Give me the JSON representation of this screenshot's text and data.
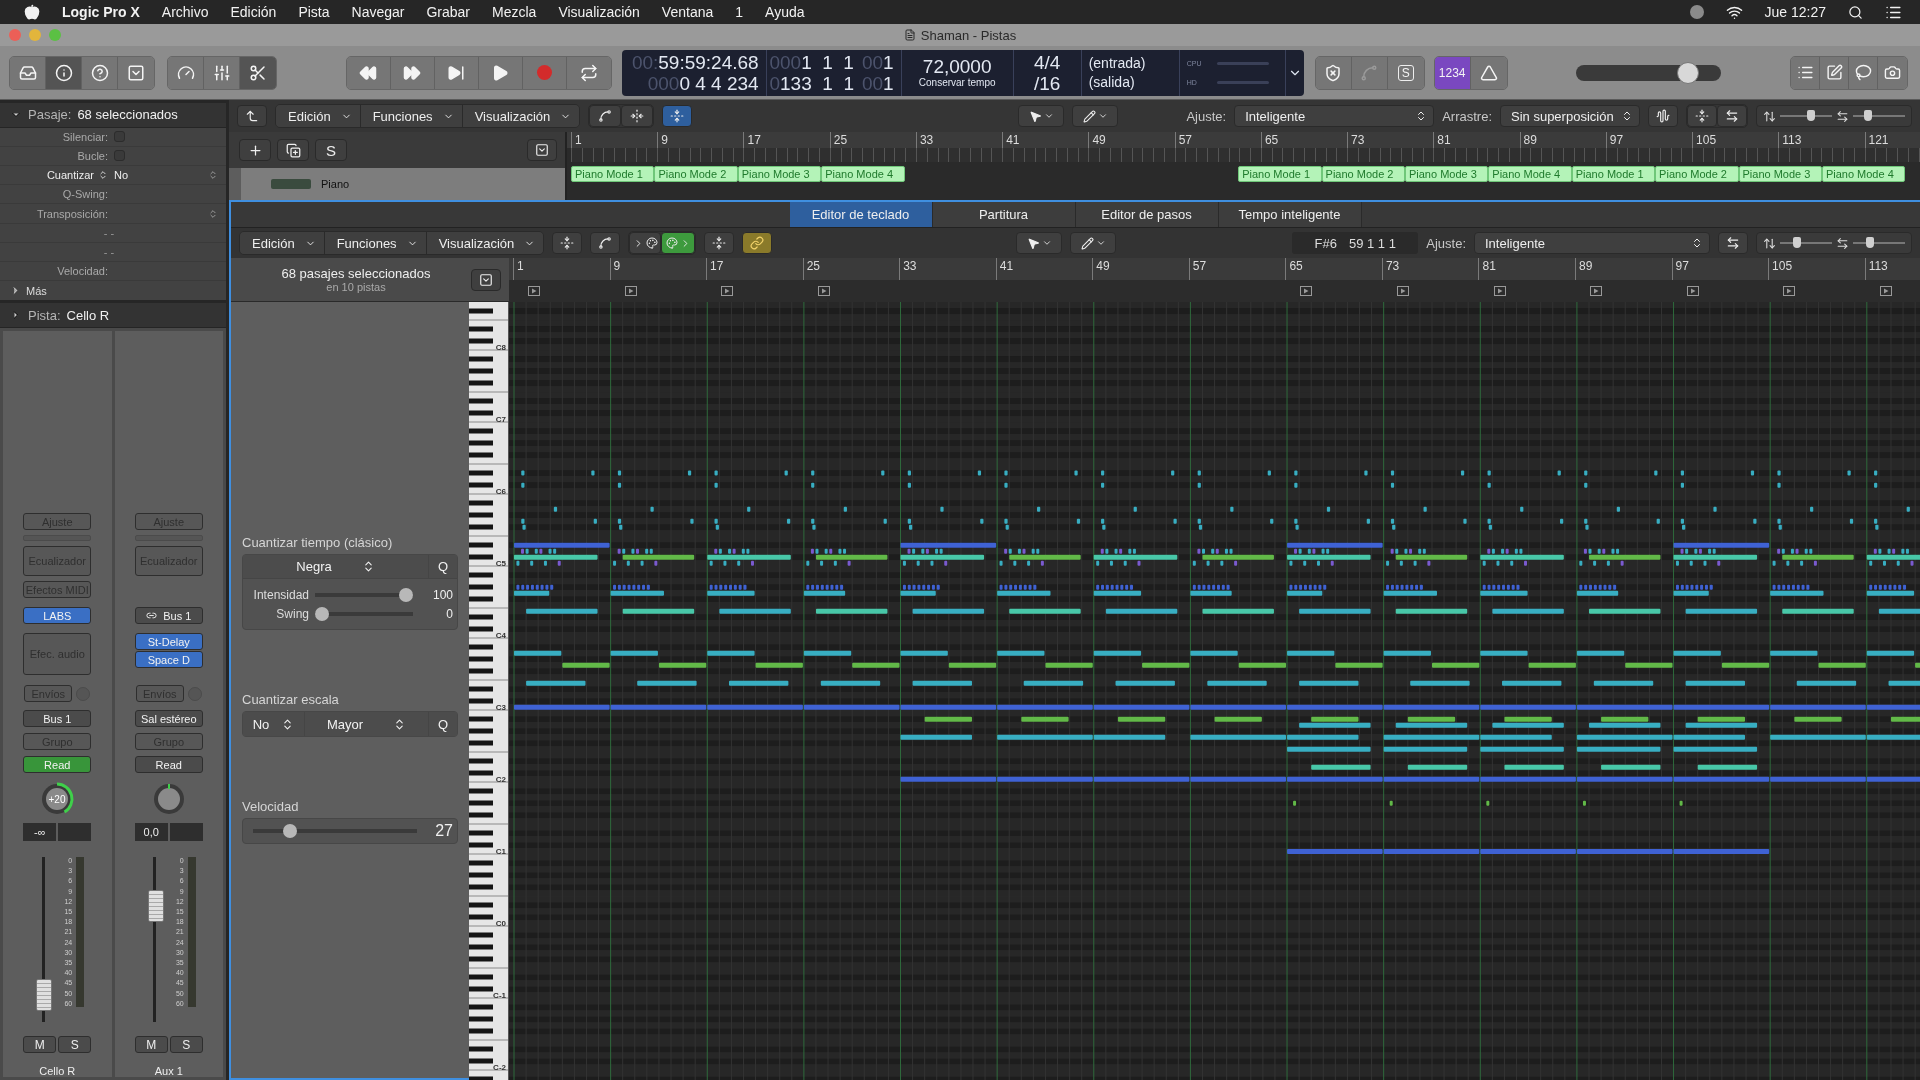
{
  "menu_bar": {
    "app": "Logic Pro X",
    "items": [
      "Archivo",
      "Edición",
      "Pista",
      "Navegar",
      "Grabar",
      "Mezcla",
      "Visualización",
      "Ventana",
      "1",
      "Ayuda"
    ],
    "clock": "Jue 12:27"
  },
  "window": {
    "title": "Shaman - Pistas"
  },
  "control_bar": {
    "view_buttons": [
      {
        "kind": "library",
        "on": false
      },
      {
        "kind": "inspector",
        "on": true
      },
      {
        "kind": "help",
        "on": false
      },
      {
        "kind": "toolbar",
        "on": false
      }
    ],
    "panel_buttons": [
      {
        "kind": "smart",
        "on": false
      },
      {
        "kind": "mixer",
        "on": false
      },
      {
        "kind": "editors",
        "on": true
      }
    ],
    "lcd": {
      "time": [
        [
          {
            "text": "00:",
            "dim": true
          },
          {
            "text": "59:59:24.68",
            "dim": false
          }
        ],
        [
          {
            "text": "000",
            "dim": true
          },
          {
            "text": "0 4 4 234",
            "dim": false
          }
        ]
      ],
      "locators": [
        [
          {
            "text": "000",
            "dim": true
          },
          {
            "text": "1  1  1",
            "dim": false
          },
          {
            "text": "00",
            "dim": true
          },
          {
            "text": "1",
            "dim": false
          }
        ],
        [
          {
            "text": "0",
            "dim": true
          },
          {
            "text": "133  1  1",
            "dim": false
          },
          {
            "text": "00",
            "dim": true
          },
          {
            "text": "1",
            "dim": false
          }
        ]
      ],
      "tempo": {
        "value": "72,0000",
        "mode": "Conservar tempo"
      },
      "signature": {
        "top": "4/4",
        "bottom": "/16"
      },
      "ports": {
        "top": "(entrada)",
        "bottom": "(salida)"
      },
      "meters": [
        "CPU",
        "HD"
      ]
    },
    "mode_buttons": [
      {
        "kind": "latency",
        "disabled": false
      },
      {
        "kind": "tuner",
        "disabled": true
      },
      {
        "kind": "solo",
        "label": "S",
        "disabled": false
      }
    ],
    "count_in": {
      "label": "1234",
      "on": true
    },
    "metronome": {
      "on": false
    },
    "master_volume": {
      "level": 0.77
    }
  },
  "inspector": {
    "region": {
      "label": "Pasaje:",
      "value": "68 seleccionados",
      "expanded": true
    },
    "rows": [
      {
        "kind": "checkbox",
        "label": "Silenciar:",
        "checked": false
      },
      {
        "kind": "checkbox",
        "label": "Bucle:",
        "checked": false
      },
      {
        "kind": "select",
        "label": "Cuantizar",
        "value": "No"
      },
      {
        "kind": "text",
        "label": "Q-Swing:"
      },
      {
        "kind": "stepper",
        "label": "Transposición:"
      },
      {
        "kind": "dashes",
        "value": "- -"
      },
      {
        "kind": "dashes",
        "value": "- -"
      },
      {
        "kind": "text",
        "label": "Velocidad:"
      }
    ],
    "more": {
      "label": "Más",
      "expanded": false
    },
    "track": {
      "label": "Pista:",
      "value": "Cello R",
      "expanded": false
    }
  },
  "channel_strips": [
    {
      "setting": "Ajuste",
      "eq": "Ecualizador",
      "midi_fx": "Efectos MIDI",
      "input": {
        "kind": "instrument",
        "label": "LABS"
      },
      "audio_fx_placeholder": "Efec. audio",
      "sends": "Envíos",
      "output": "Bus 1",
      "group": "Grupo",
      "automation": {
        "label": "Read",
        "active": true
      },
      "pan": {
        "label": "+20"
      },
      "volume": "-∞",
      "fader": {
        "level": 0.08
      },
      "scale": [
        "0",
        "3",
        "6",
        "9",
        "12",
        "15",
        "18",
        "21",
        "24",
        "30",
        "35",
        "40",
        "45",
        "50",
        "60"
      ],
      "mute": "M",
      "solo": "S",
      "name": "Cello R"
    },
    {
      "setting": "Ajuste",
      "eq": "Ecualizador",
      "input": {
        "kind": "bus",
        "label": "Bus 1"
      },
      "audio_fx": [
        "St-Delay",
        "Space D"
      ],
      "sends": "Envíos",
      "output": "Sal estéreo",
      "group": "Grupo",
      "automation": {
        "label": "Read",
        "active": false
      },
      "volume": "0,0",
      "fader": {
        "level": 0.75
      },
      "scale": [
        "0",
        "3",
        "6",
        "9",
        "12",
        "15",
        "18",
        "21",
        "24",
        "30",
        "35",
        "40",
        "45",
        "50",
        "60"
      ],
      "mute": "M",
      "solo": "S",
      "name": "Aux 1"
    }
  ],
  "tracks_area": {
    "menus": [
      "Edición",
      "Funciones",
      "Visualización"
    ],
    "snap": {
      "label": "Ajuste:",
      "value": "Inteligente"
    },
    "drag": {
      "label": "Arrastre:",
      "value": "Sin superposición"
    },
    "zoom": [
      {
        "kind": "vertical",
        "level": 0.62
      },
      {
        "kind": "horizontal",
        "level": 0.25
      }
    ],
    "header_button": "S",
    "track": {
      "name": "Piano"
    },
    "ruler": [
      "1",
      "9",
      "17",
      "25",
      "33",
      "41",
      "49",
      "57",
      "65",
      "73",
      "81",
      "89",
      "97",
      "105",
      "113",
      "121"
    ],
    "region_groups": [
      [
        "Piano Mode 1",
        "Piano Mode 2",
        "Piano Mode 3",
        "Piano Mode 4"
      ],
      [
        "Piano Mode 1",
        "Piano Mode 2",
        "Piano Mode 3",
        "Piano Mode 4",
        "Piano Mode 1",
        "Piano Mode 2",
        "Piano Mode 3",
        "Piano Mode 4"
      ]
    ]
  },
  "editor": {
    "tabs": [
      {
        "label": "Editor de teclado",
        "selected": true
      },
      {
        "label": "Partitura",
        "selected": false
      },
      {
        "label": "Editor de pasos",
        "selected": false
      },
      {
        "label": "Tempo inteligente",
        "selected": false
      }
    ],
    "menus": [
      "Edición",
      "Funciones",
      "Visualización"
    ],
    "position": {
      "pitch": "F#6",
      "bar": "59 1 1 1"
    },
    "snap": {
      "label": "Ajuste:",
      "value": "Inteligente"
    },
    "zoom": [
      {
        "kind": "vertical",
        "level": 0.3
      },
      {
        "kind": "horizontal",
        "level": 0.3
      }
    ],
    "ruler": [
      "1",
      "9",
      "17",
      "25",
      "33",
      "41",
      "49",
      "57",
      "65",
      "73",
      "81",
      "89",
      "97",
      "105",
      "113"
    ],
    "summary": {
      "title": "68 pasajes seleccionados",
      "subtitle": "en 10 pistas"
    },
    "quantize_time": {
      "title": "Cuantizar tiempo (clásico)",
      "value": "Negra",
      "button": "Q",
      "sliders": [
        {
          "label": "Intensidad",
          "level": 1,
          "reading": "100"
        },
        {
          "label": "Swing",
          "level": 0,
          "reading": "0"
        }
      ]
    },
    "quantize_scale": {
      "title": "Cuantizar escala",
      "root": "No",
      "scale": "Mayor",
      "button": "Q"
    },
    "velocity": {
      "title": "Velocidad",
      "level": 0.2,
      "reading": "27"
    },
    "keyboard": [
      "C8",
      "C7",
      "C6",
      "C5",
      "C4",
      "C3",
      "C2",
      "C1",
      "C0",
      "C-1",
      "C-2"
    ]
  }
}
